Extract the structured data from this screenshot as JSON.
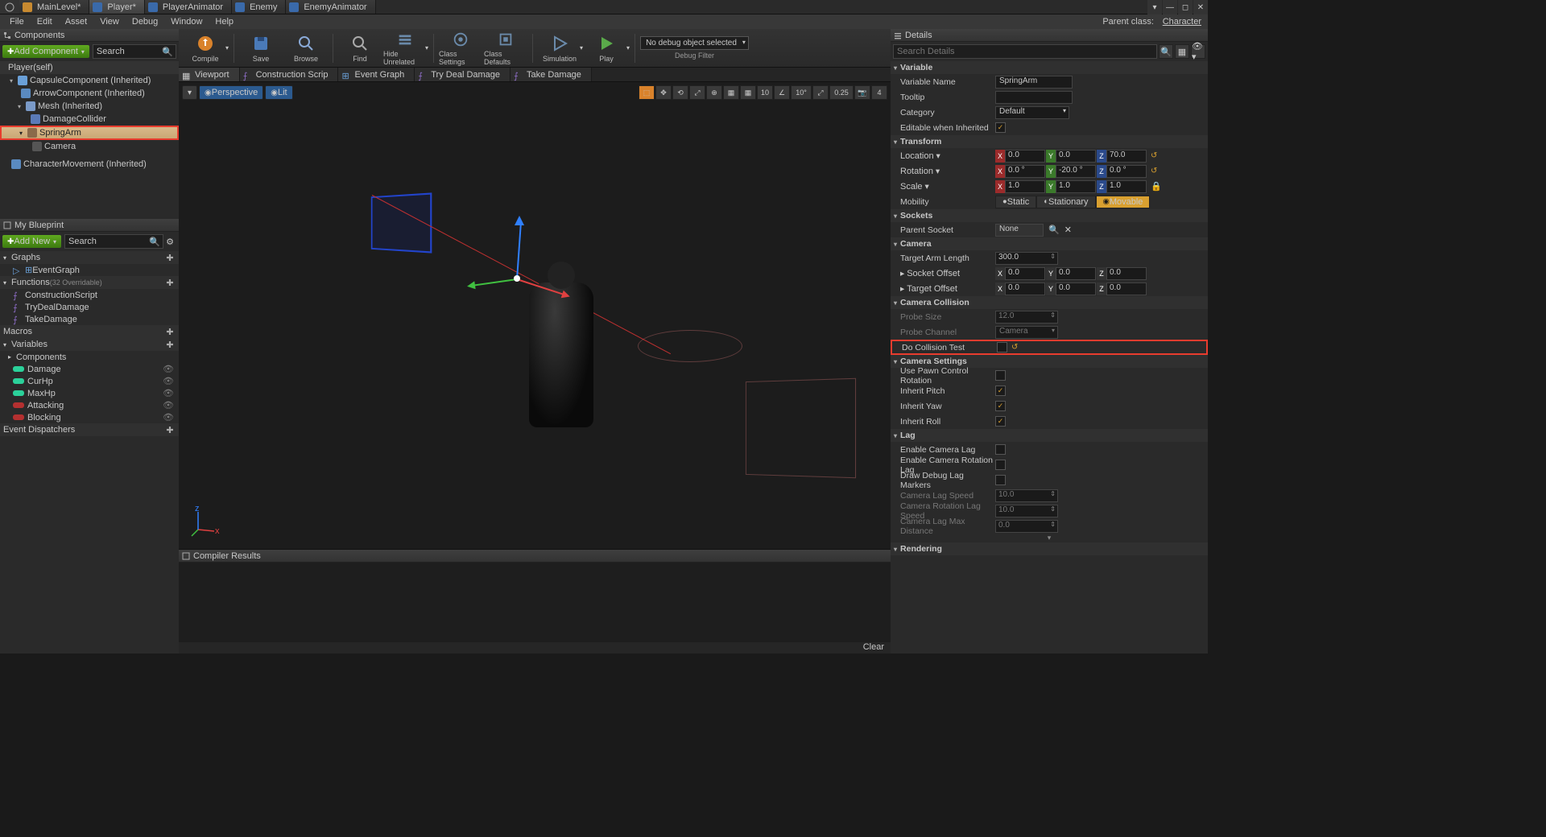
{
  "tabs": [
    "MainLevel*",
    "Player*",
    "PlayerAnimator",
    "Enemy",
    "EnemyAnimator"
  ],
  "menu": [
    "File",
    "Edit",
    "Asset",
    "View",
    "Debug",
    "Window",
    "Help"
  ],
  "parentClass": "Character",
  "parentLabel": "Parent class:",
  "componentsPanel": {
    "title": "Components",
    "addLabel": "Add Component",
    "searchPlaceholder": "Search",
    "root": "Player(self)",
    "items": [
      {
        "label": "CapsuleComponent (Inherited)",
        "indent": 1
      },
      {
        "label": "ArrowComponent (Inherited)",
        "indent": 2
      },
      {
        "label": "Mesh (Inherited)",
        "indent": 2
      },
      {
        "label": "DamageCollider",
        "indent": 3
      },
      {
        "label": "SpringArm",
        "indent": 2,
        "selected": true
      },
      {
        "label": "Camera",
        "indent": 3,
        "dim": true
      },
      {
        "label": "CharacterMovement (Inherited)",
        "indent": 1
      }
    ]
  },
  "myBlueprint": {
    "title": "My Blueprint",
    "addLabel": "Add New",
    "searchPlaceholder": "Search",
    "sections": {
      "graphs": "Graphs",
      "eventGraph": "EventGraph",
      "functions": "Functions",
      "functionsHint": "(32 Overridable)",
      "fnItems": [
        "ConstructionScript",
        "TryDealDamage",
        "TakeDamage"
      ],
      "macros": "Macros",
      "variables": "Variables",
      "componentsVar": "Components",
      "vars": [
        {
          "name": "Damage",
          "color": "#2bd19a"
        },
        {
          "name": "CurHp",
          "color": "#2bd19a"
        },
        {
          "name": "MaxHp",
          "color": "#2bd19a"
        },
        {
          "name": "Attacking",
          "color": "#b43030"
        },
        {
          "name": "Blocking",
          "color": "#b43030"
        }
      ],
      "dispatchers": "Event Dispatchers"
    }
  },
  "toolbar": [
    {
      "label": "Compile",
      "color": "#d9822b",
      "dd": true
    },
    {
      "label": "Save",
      "color": "#4a7ab8"
    },
    {
      "label": "Browse",
      "color": "#4a7ab8"
    },
    {
      "label": "Find",
      "color": "#8a8a8a"
    },
    {
      "label": "Hide Unrelated",
      "color": "#6a8aaa",
      "dd": true
    },
    {
      "label": "Class Settings",
      "color": "#6a8aaa"
    },
    {
      "label": "Class Defaults",
      "color": "#6a8aaa"
    },
    {
      "label": "Simulation",
      "color": "#6a8aaa",
      "dd": true
    },
    {
      "label": "Play",
      "color": "#5aaa4a",
      "dd": true
    }
  ],
  "debugFilter": {
    "selected": "No debug object selected",
    "label": "Debug Filter"
  },
  "graphTabs": [
    "Viewport",
    "Construction Scrip",
    "Event Graph",
    "Try Deal Damage",
    "Take Damage"
  ],
  "viewport": {
    "perspective": "Perspective",
    "lit": "Lit",
    "snap": {
      "grid": "10",
      "angle": "10°",
      "scale": "0.25",
      "cam": "4"
    }
  },
  "compilerResults": {
    "title": "Compiler Results",
    "clear": "Clear"
  },
  "details": {
    "title": "Details",
    "searchPlaceholder": "Search Details",
    "variable": {
      "header": "Variable",
      "name": {
        "label": "Variable Name",
        "value": "SpringArm"
      },
      "tooltip": {
        "label": "Tooltip",
        "value": ""
      },
      "category": {
        "label": "Category",
        "value": "Default"
      },
      "editable": {
        "label": "Editable when Inherited"
      }
    },
    "transform": {
      "header": "Transform",
      "location": {
        "label": "Location",
        "x": "0.0",
        "y": "0.0",
        "z": "70.0"
      },
      "rotation": {
        "label": "Rotation",
        "x": "0.0 °",
        "y": "-20.0 °",
        "z": "0.0 °"
      },
      "scale": {
        "label": "Scale",
        "x": "1.0",
        "y": "1.0",
        "z": "1.0"
      },
      "mobility": {
        "label": "Mobility",
        "options": [
          "Static",
          "Stationary",
          "Movable"
        ],
        "selected": "Movable"
      }
    },
    "sockets": {
      "header": "Sockets",
      "parent": {
        "label": "Parent Socket",
        "value": "None"
      }
    },
    "camera": {
      "header": "Camera",
      "arm": {
        "label": "Target Arm Length",
        "value": "300.0"
      },
      "socketOffset": {
        "label": "Socket Offset",
        "x": "0.0",
        "y": "0.0",
        "z": "0.0"
      },
      "targetOffset": {
        "label": "Target Offset",
        "x": "0.0",
        "y": "0.0",
        "z": "0.0"
      }
    },
    "cameraCollision": {
      "header": "Camera Collision",
      "probeSize": {
        "label": "Probe Size",
        "value": "12.0"
      },
      "probeChannel": {
        "label": "Probe Channel",
        "value": "Camera"
      },
      "doTest": {
        "label": "Do Collision Test"
      }
    },
    "cameraSettings": {
      "header": "Camera Settings",
      "usePawn": {
        "label": "Use Pawn Control Rotation"
      },
      "inheritPitch": {
        "label": "Inherit Pitch"
      },
      "inheritYaw": {
        "label": "Inherit Yaw"
      },
      "inheritRoll": {
        "label": "Inherit Roll"
      }
    },
    "lag": {
      "header": "Lag",
      "enableLag": {
        "label": "Enable Camera Lag"
      },
      "enableRotLag": {
        "label": "Enable Camera Rotation Lag"
      },
      "drawMarkers": {
        "label": "Draw Debug Lag Markers"
      },
      "lagSpeed": {
        "label": "Camera Lag Speed",
        "value": "10.0"
      },
      "rotLagSpeed": {
        "label": "Camera Rotation Lag Speed",
        "value": "10.0"
      },
      "maxDist": {
        "label": "Camera Lag Max Distance",
        "value": "0.0"
      }
    },
    "rendering": {
      "header": "Rendering"
    }
  }
}
